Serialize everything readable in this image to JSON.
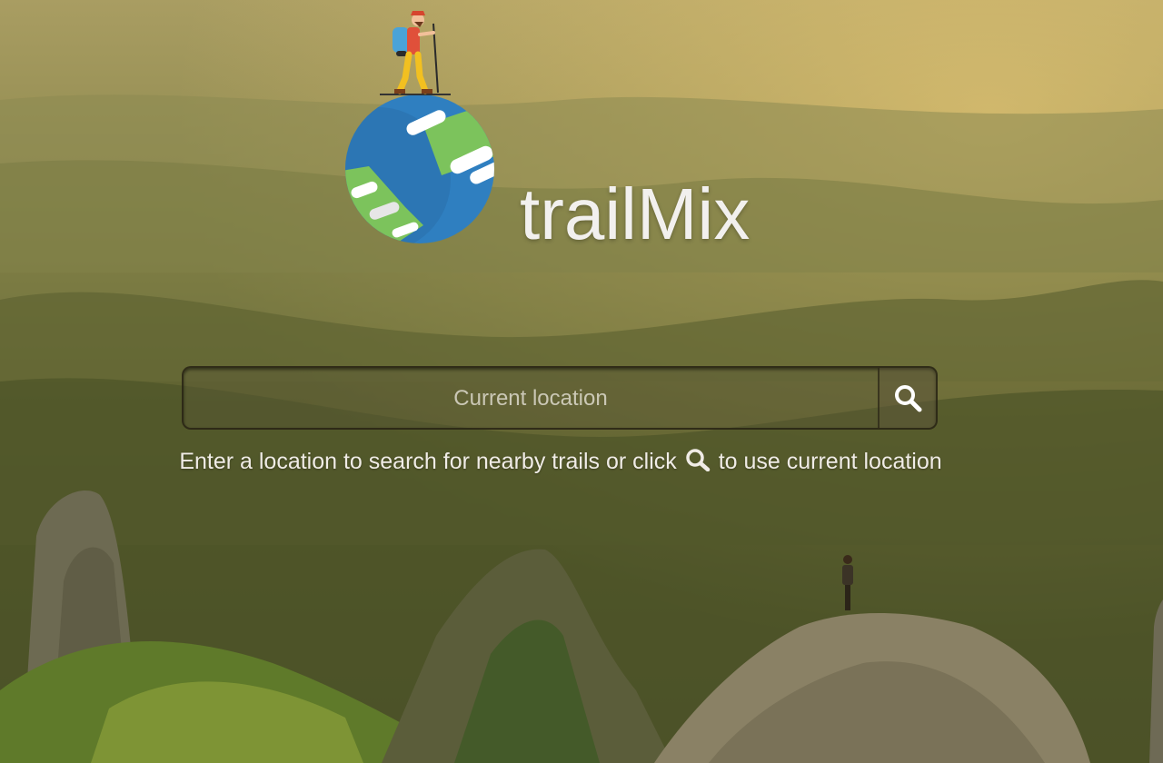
{
  "brand": {
    "name": "trailMix",
    "logo_icon": "hiker-on-globe-icon"
  },
  "search": {
    "placeholder": "Current location",
    "value": "",
    "button_icon": "search-icon"
  },
  "hint": {
    "before": "Enter a location to search for nearby trails or click",
    "icon": "search-icon",
    "after": "to use current location"
  },
  "colors": {
    "text": "#f2f0ee",
    "globe_blue": "#2f7fc0",
    "globe_green": "#7cc35c"
  }
}
